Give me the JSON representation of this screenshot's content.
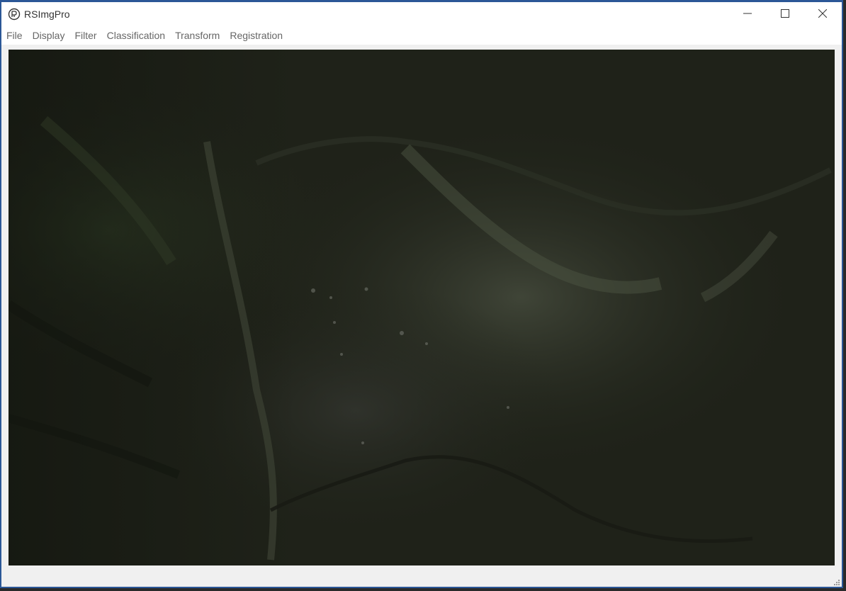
{
  "window": {
    "title": "RSImgPro",
    "icon": "app-logo-icon",
    "controls": {
      "minimize": "minimize-icon",
      "maximize": "maximize-icon",
      "close": "close-icon"
    }
  },
  "menu": {
    "items": [
      {
        "label": "File"
      },
      {
        "label": "Display"
      },
      {
        "label": "Filter"
      },
      {
        "label": "Classification"
      },
      {
        "label": "Transform"
      },
      {
        "label": "Registration"
      }
    ]
  },
  "image": {
    "subject": "satellite-terrain-image",
    "colors": {
      "base": "#1f2219",
      "ridge_light": "#5d6650",
      "valley_dark": "#0f120c",
      "urban": "#3a3d38"
    }
  },
  "theme": {
    "accent": "#2b5797",
    "menu_text": "#666666",
    "background": "#f0f0f0"
  }
}
